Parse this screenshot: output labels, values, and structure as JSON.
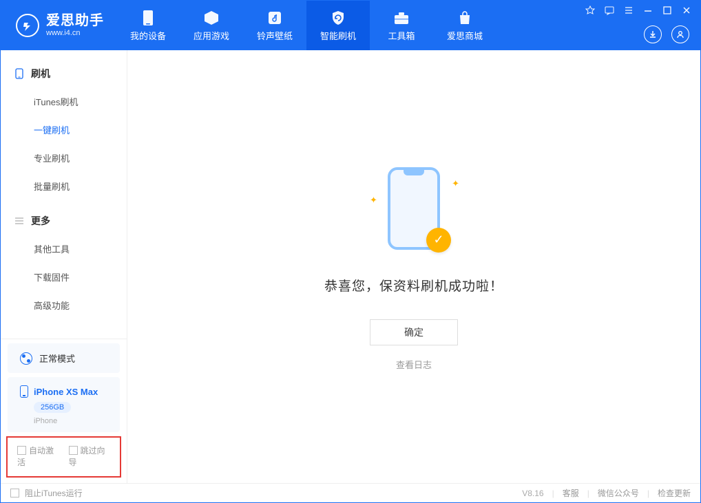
{
  "app": {
    "name_cn": "爱思助手",
    "name_en": "www.i4.cn"
  },
  "nav": {
    "my_device": "我的设备",
    "apps_games": "应用游戏",
    "ring_wall": "铃声壁纸",
    "smart_flash": "智能刷机",
    "toolbox": "工具箱",
    "store": "爱思商城"
  },
  "sidebar": {
    "group_flash": "刷机",
    "items_flash": {
      "itunes": "iTunes刷机",
      "onekey": "一键刷机",
      "pro": "专业刷机",
      "batch": "批量刷机"
    },
    "group_more": "更多",
    "items_more": {
      "other_tools": "其他工具",
      "download_fw": "下载固件",
      "advanced": "高级功能"
    },
    "mode": "正常模式",
    "device_name": "iPhone XS Max",
    "device_cap": "256GB",
    "device_type": "iPhone",
    "opt_auto_activate": "自动激活",
    "opt_skip_guide": "跳过向导"
  },
  "main": {
    "success_msg": "恭喜您，保资料刷机成功啦！",
    "ok": "确定",
    "view_log": "查看日志"
  },
  "footer": {
    "block_itunes": "阻止iTunes运行",
    "version": "V8.16",
    "support": "客服",
    "wechat": "微信公众号",
    "check_update": "检查更新"
  }
}
